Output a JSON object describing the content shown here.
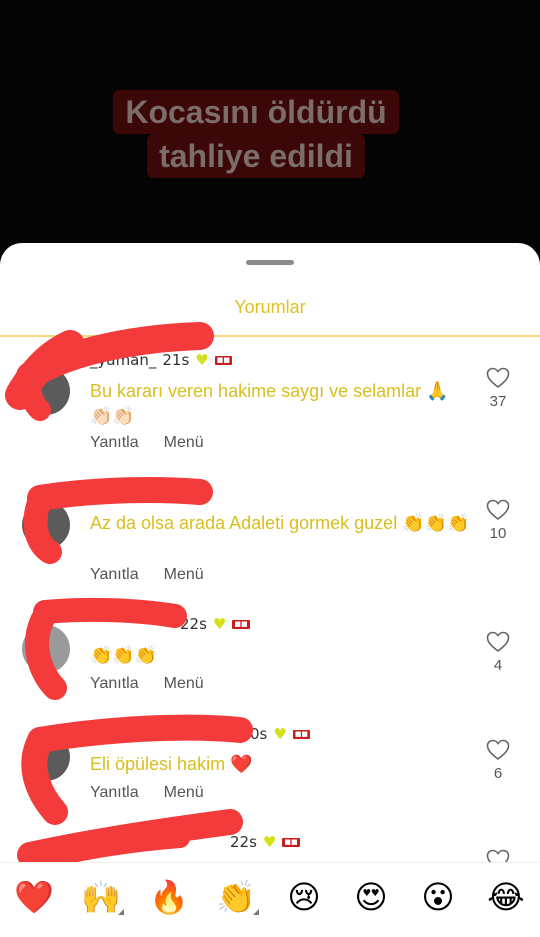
{
  "video": {
    "caption_line1": "Kocasını öldürdü",
    "caption_line2": "tahliye edildi"
  },
  "sheet": {
    "title": "Yorumlar"
  },
  "comments": [
    {
      "username": "_yaman_",
      "time": "21s",
      "text": "Bu kararı veren hakime saygı ve selamlar 🙏👏🏻👏🏻",
      "reply": "Yanıtla",
      "menu": "Menü",
      "likes": "37"
    },
    {
      "username": "",
      "time": "",
      "text": "Az da olsa arada Adaleti gormek guzel 👏👏👏",
      "reply": "Yanıtla",
      "menu": "Menü",
      "likes": "10"
    },
    {
      "username": "",
      "time": "22s",
      "text": "👏👏👏",
      "reply": "Yanıtla",
      "menu": "Menü",
      "likes": "4"
    },
    {
      "username": "",
      "time": "0s",
      "text": "Eli öpülesi hakim ❤️",
      "reply": "Yanıtla",
      "menu": "Menü",
      "likes": "6"
    },
    {
      "username": "",
      "time": "22s"
    }
  ],
  "emoji_bar": [
    "❤️",
    "🙌",
    "🔥",
    "👏",
    "😢",
    "😍",
    "😮",
    "😂"
  ]
}
